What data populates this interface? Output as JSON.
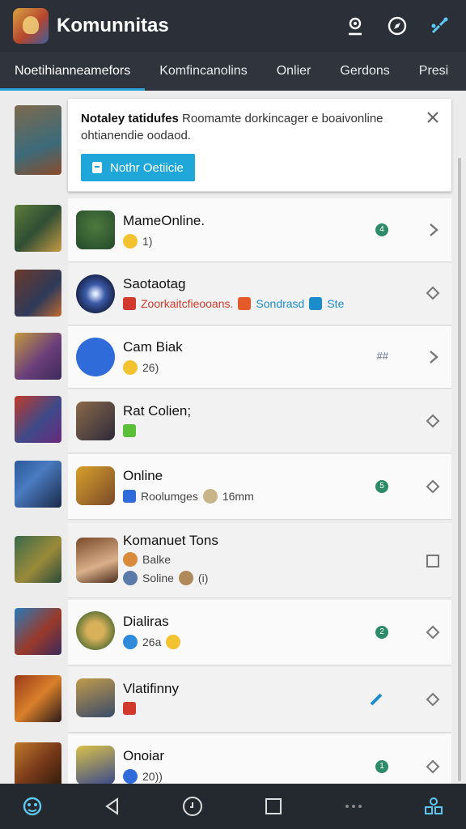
{
  "app": {
    "title": "Komunnitas"
  },
  "tabs": [
    {
      "label": "Noetihianneamefors"
    },
    {
      "label": "Komfincanolins"
    },
    {
      "label": "Onlier"
    },
    {
      "label": "Gerdons"
    },
    {
      "label": "Presi"
    }
  ],
  "notice": {
    "title": "Notaley tatidufes",
    "text": "Roomamte dorkincager e boaivonline ohtianendie oodaod.",
    "button_label": "Nothr Oetiicie"
  },
  "items": [
    {
      "name": "MameOnline.",
      "sub": "1)",
      "badge": "4"
    },
    {
      "name": "Saotaotag",
      "sub_red": "Zoorkaitcfieooans.",
      "sub_blue": "Sondrasd",
      "sub_blue2": "Ste"
    },
    {
      "name": "Cam Biak",
      "sub": "26)",
      "badge_text": "##"
    },
    {
      "name": "Rat Colien;"
    },
    {
      "name": "Online",
      "sub": "Roolumges",
      "sub2": "16mm",
      "badge": "5"
    },
    {
      "name": "Komanuet Tons",
      "sub": "Balke",
      "sub2": "Soline",
      "sub3": "(i)"
    },
    {
      "name": "Dialiras",
      "sub": "26a",
      "badge": "2"
    },
    {
      "name": "Vlatifinny"
    },
    {
      "name": "Onoiar",
      "sub": "20))",
      "badge": "1"
    }
  ],
  "colors": {
    "appbar": "#2a2f38",
    "accent": "#1ea7d8",
    "badge": "#2e8b6a"
  }
}
